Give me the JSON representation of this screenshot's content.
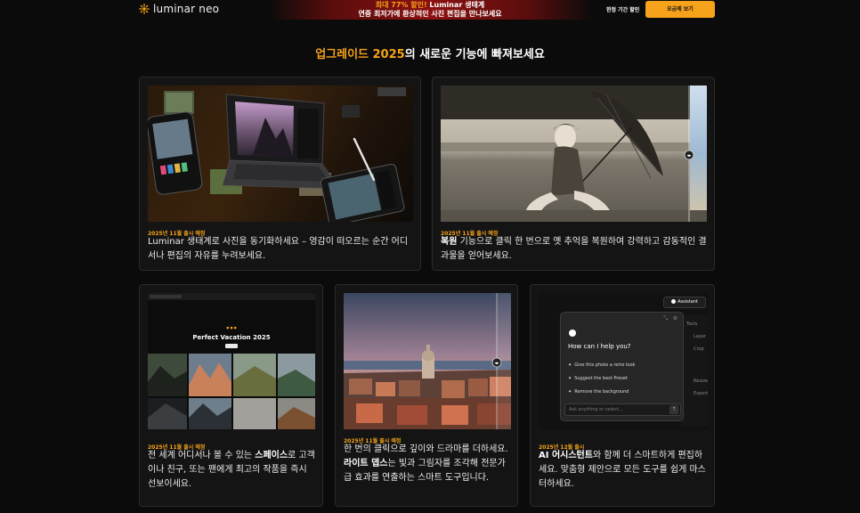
{
  "topbar": {
    "brand": "luminar neo",
    "promo_highlight": "최대 77% 할인!",
    "promo_title": "Luminar 생태계",
    "promo_line2": "연중 최저가에 환상적인 사진 편집을 만나보세요",
    "trial_link": "한정 기간 할인",
    "cta_label": "요금제 보기"
  },
  "heading": {
    "highlight": "업그레이드 2025",
    "rest": "의 새로운 기능에 빠져보세요"
  },
  "cards": [
    {
      "date": "2025년 11월 출시 예정",
      "text_before": "",
      "bold": "",
      "text_after": "Luminar 생태계로 사진을 동기화하세요 – 영감이 떠오르는 순간 어디서나 편집의 자유를 누려보세요."
    },
    {
      "date": "2025년 11월 출시 예정",
      "text_before": "",
      "bold": "복원",
      "text_after": " 기능으로 클릭 한 번으로 옛 추억을 복원하여 강력하고 감동적인 결과물을 얻어보세요."
    },
    {
      "date": "2025년 11월 출시 예정",
      "text_before": "전 세계 어디서나 볼 수 있는 ",
      "bold": "스페이스",
      "text_after": "로 고객이나 친구, 또는 팬에게 최고의 작품을 즉시 선보이세요.",
      "gallery_title": "Perfect Vacation 2025"
    },
    {
      "date": "2025년 11월 출시 예정",
      "text_before": "한 번의 클릭으로 깊이와 드라마를 더하세요. ",
      "bold": "라이트 뎁스",
      "text_after": "는 빛과 그림자를 조각해 전문가급 효과를 연출하는 스마트 도구입니다."
    },
    {
      "date": "2025년 12월 출시",
      "text_before": "",
      "bold": "AI 어시스턴트",
      "text_after": "와 함께 더 스마트하게 편집하세요. 맞춤형 제안으로 모든 도구를 쉽게 마스터하세요.",
      "assistant_button": "Assistant",
      "assistant_prompt": "How can I help you?",
      "suggestions": [
        "Give this photo a retro look",
        "Suggest the best Preset",
        "Remove the background"
      ],
      "input_placeholder": "Ask anything or select...",
      "side_menu": [
        "Tools",
        "Layer",
        "Crop",
        "Resize",
        "Export"
      ]
    }
  ],
  "colors": {
    "accent": "#f7a21b",
    "promo_red": "#8c1010",
    "card_bg": "#141414"
  }
}
